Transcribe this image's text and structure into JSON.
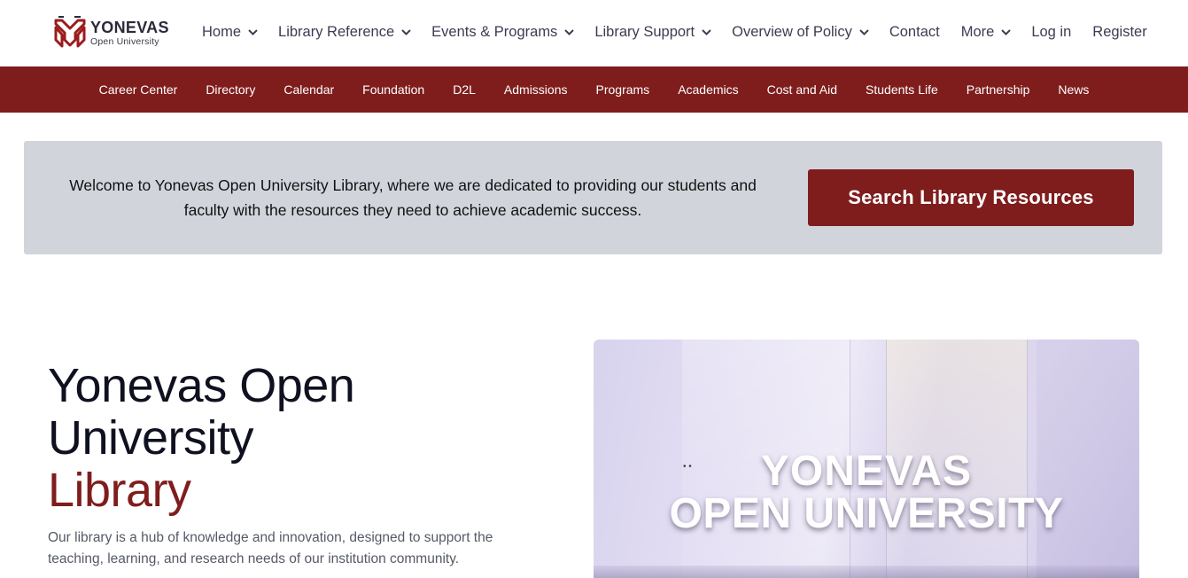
{
  "brand": {
    "name": "YONEVAS",
    "sub": "Open University",
    "accent_color": "#7f1d1d"
  },
  "main_nav": [
    {
      "label": "Home",
      "dropdown": true
    },
    {
      "label": "Library Reference",
      "dropdown": true
    },
    {
      "label": "Events & Programs",
      "dropdown": true
    },
    {
      "label": "Library Support",
      "dropdown": true
    },
    {
      "label": "Overview of Policy",
      "dropdown": true
    },
    {
      "label": "Contact",
      "dropdown": false
    },
    {
      "label": "More",
      "dropdown": true
    },
    {
      "label": "Log in",
      "dropdown": false
    },
    {
      "label": "Register",
      "dropdown": false
    }
  ],
  "sub_nav": [
    "Career Center",
    "Directory",
    "Calendar",
    "Foundation",
    "D2L",
    "Admissions",
    "Programs",
    "Academics",
    "Cost and Aid",
    "Students Life",
    "Partnership",
    "News"
  ],
  "banner": {
    "text": "Welcome to Yonevas Open University Library, where we are dedicated to providing our students and faculty with the resources they need to achieve academic success.",
    "button_label": "Search Library Resources"
  },
  "hero": {
    "title_line1": "Yonevas Open",
    "title_line2": "University",
    "title_accent": "Library",
    "description": "Our library is a hub of knowledge and innovation, designed to support the teaching, learning, and research needs of our institution community.",
    "image_overlay_line1": "YONEVAS",
    "image_overlay_line2": "OPEN UNIVERSITY"
  }
}
